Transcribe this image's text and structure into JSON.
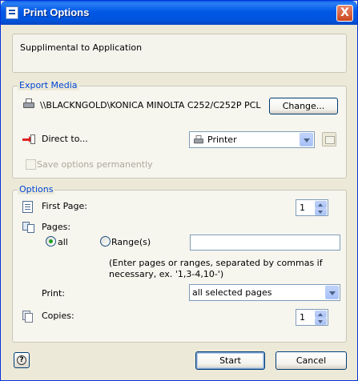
{
  "window": {
    "title": "Print Options",
    "close_glyph": "X"
  },
  "info": {
    "text": "Supplimental to Application"
  },
  "export_media": {
    "legend": "Export Media",
    "printer_icon": "printer-icon",
    "printer_name": "\\\\BLACKNGOLD\\KONICA MINOLTA C252/C252P PCL",
    "change_label": "Change...",
    "direct_to_label": "Direct to...",
    "direct_to_value": "Printer",
    "save_options_label": "Save options permanently",
    "save_options_checked": false,
    "save_options_enabled": false
  },
  "options": {
    "legend": "Options",
    "first_page_label": "First Page:",
    "first_page_value": "1",
    "pages_label": "Pages:",
    "all_label": "all",
    "ranges_label": "Range(s)",
    "pages_selected": "all",
    "range_value": "",
    "note": "(Enter pages or ranges, separated by commas if necessary, ex. '1,3-4,10-')",
    "print_label": "Print:",
    "print_value": "all selected pages",
    "copies_label": "Copies:",
    "copies_value": "1"
  },
  "footer": {
    "help_glyph": "?",
    "start_label": "Start",
    "cancel_label": "Cancel"
  },
  "colors": {
    "titlebar": "#0054dd",
    "group_legend": "#0046d5",
    "dialog_bg": "#ece9d8"
  }
}
